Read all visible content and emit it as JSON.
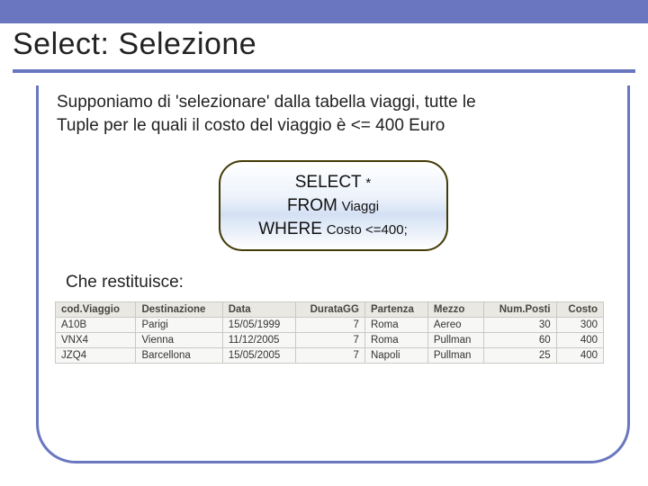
{
  "header": {
    "title": "Select: Selezione"
  },
  "body": {
    "description_line1": "Supponiamo di 'selezionare' dalla tabella viaggi, tutte le",
    "description_line2": "Tuple per le quali il costo del viaggio è <= 400 Euro",
    "returns_label": "Che restituisce:"
  },
  "sql": {
    "kw_select": "SELECT",
    "arg_select": "*",
    "kw_from": "FROM",
    "arg_from": "Viaggi",
    "kw_where": "WHERE",
    "arg_where": "Costo <=400;"
  },
  "table": {
    "headers": [
      "cod.Viaggio",
      "Destinazione",
      "Data",
      "DurataGG",
      "Partenza",
      "Mezzo",
      "Num.Posti",
      "Costo"
    ],
    "rows": [
      {
        "cells": [
          "A10B",
          "Parigi",
          "15/05/1999",
          "7",
          "Roma",
          "Aereo",
          "30",
          "300"
        ]
      },
      {
        "cells": [
          "VNX4",
          "Vienna",
          "11/12/2005",
          "7",
          "Roma",
          "Pullman",
          "60",
          "400"
        ]
      },
      {
        "cells": [
          "JZQ4",
          "Barcellona",
          "15/05/2005",
          "7",
          "Napoli",
          "Pullman",
          "25",
          "400"
        ]
      }
    ]
  }
}
